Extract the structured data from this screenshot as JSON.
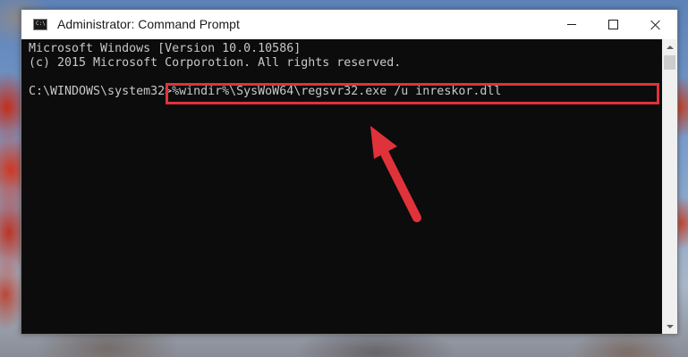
{
  "window": {
    "title": "Administrator: Command Prompt",
    "icon": "cmd-icon",
    "icon_text": "C:\\"
  },
  "controls": {
    "minimize_icon": "minimize-icon",
    "maximize_icon": "maximize-icon",
    "close_icon": "close-icon"
  },
  "console": {
    "lines": [
      "Microsoft Windows [Version 10.0.10586]",
      "(c) 2015 Microsoft Corporotion. All rights reserved."
    ],
    "prompt": "C:\\WINDOWS\\system32>",
    "command": "%windir%\\SysWoW64\\regsvr32.exe /u inreskor.dll"
  },
  "annotation": {
    "highlight_color": "#e0323a",
    "arrow_color": "#e0323a"
  },
  "colors": {
    "console_bg": "#0c0c0c",
    "console_text": "#c8c8c8"
  }
}
